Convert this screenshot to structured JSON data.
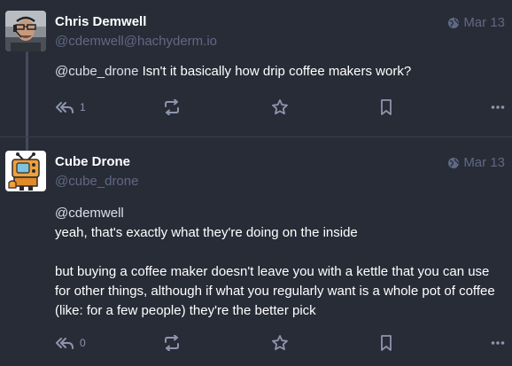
{
  "statuses": [
    {
      "author_name": "Chris Demwell",
      "handle": "@cdemwell@hachyderm.io",
      "visibility_icon": "globe-icon",
      "date": "Mar 13",
      "mention": "@cube_drone",
      "text": " Isn't it basically how drip coffee makers work?",
      "reply_count": "1"
    },
    {
      "author_name": "Cube Drone",
      "handle": "@cube_drone",
      "visibility_icon": "globe-icon",
      "date": "Mar 13",
      "mention": "@cdemwell",
      "line1": "yeah, that's exactly what they're doing on the inside",
      "paragraph2": "but buying a coffee maker doesn't leave you with a kettle that you can use for other things, although if what you regularly want is a whole pot of coffee (like: for a few people) they're the better pick",
      "reply_count": "0"
    }
  ],
  "colors": {
    "background": "#282c37",
    "muted": "#606984",
    "action": "#8d95ad",
    "text": "#ffffff"
  }
}
